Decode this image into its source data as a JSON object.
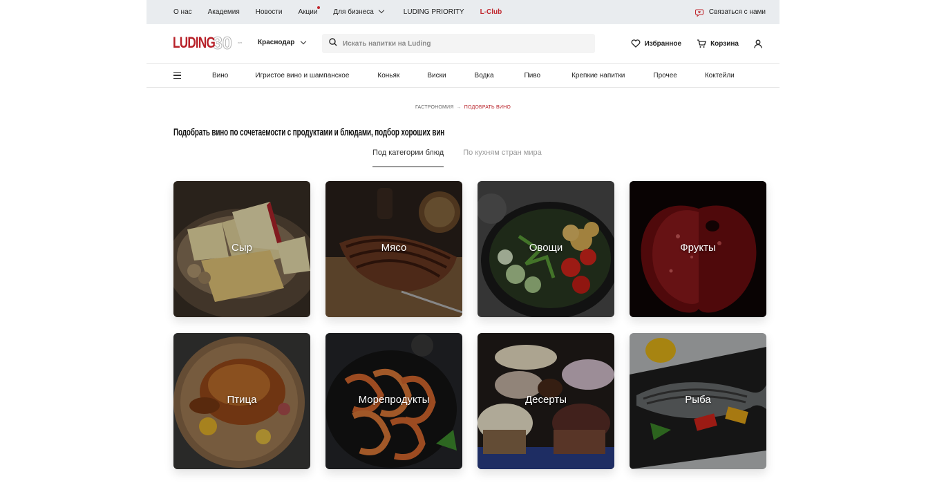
{
  "topbar": {
    "links": [
      {
        "label": "О нас"
      },
      {
        "label": "Академия"
      },
      {
        "label": "Новости"
      },
      {
        "label": "Акции"
      },
      {
        "label": "Для бизнеса"
      },
      {
        "label": "LUDING PRIORITY"
      },
      {
        "label": "L-Club"
      }
    ],
    "contact_label": "Связаться с нами",
    "accent_color": "#c0282f"
  },
  "header": {
    "logo_text": "LUDING",
    "logo_number": "30",
    "logo_sub": "лет",
    "city": "Краснодар",
    "search_placeholder": "Искать напитки на Luding",
    "favorites_label": "Избранное",
    "cart_label": "Корзина"
  },
  "categories": [
    "Вино",
    "Игристое вино и шампанское",
    "Коньяк",
    "Виски",
    "Водка",
    "Пиво",
    "Крепкие напитки",
    "Прочее",
    "Коктейли"
  ],
  "breadcrumb": {
    "parent": "Гастрономия",
    "separator": "→",
    "current": "Подобрать вино"
  },
  "page_title": "Подобрать вино по сочетаемости с продуктами и блюдами, подбор хороших вин",
  "tabs": [
    {
      "label": "Под категории блюд",
      "active": true
    },
    {
      "label": "По кухням стран мира",
      "active": false
    }
  ],
  "cards": [
    {
      "label": "Сыр",
      "icon": "cheese-image"
    },
    {
      "label": "Мясо",
      "icon": "meat-image"
    },
    {
      "label": "Овощи",
      "icon": "vegetables-image"
    },
    {
      "label": "Фрукты",
      "icon": "apple-image"
    },
    {
      "label": "Птица",
      "icon": "poultry-image"
    },
    {
      "label": "Морепродукты",
      "icon": "seafood-image"
    },
    {
      "label": "Десерты",
      "icon": "desserts-image"
    },
    {
      "label": "Рыба",
      "icon": "fish-image"
    }
  ]
}
